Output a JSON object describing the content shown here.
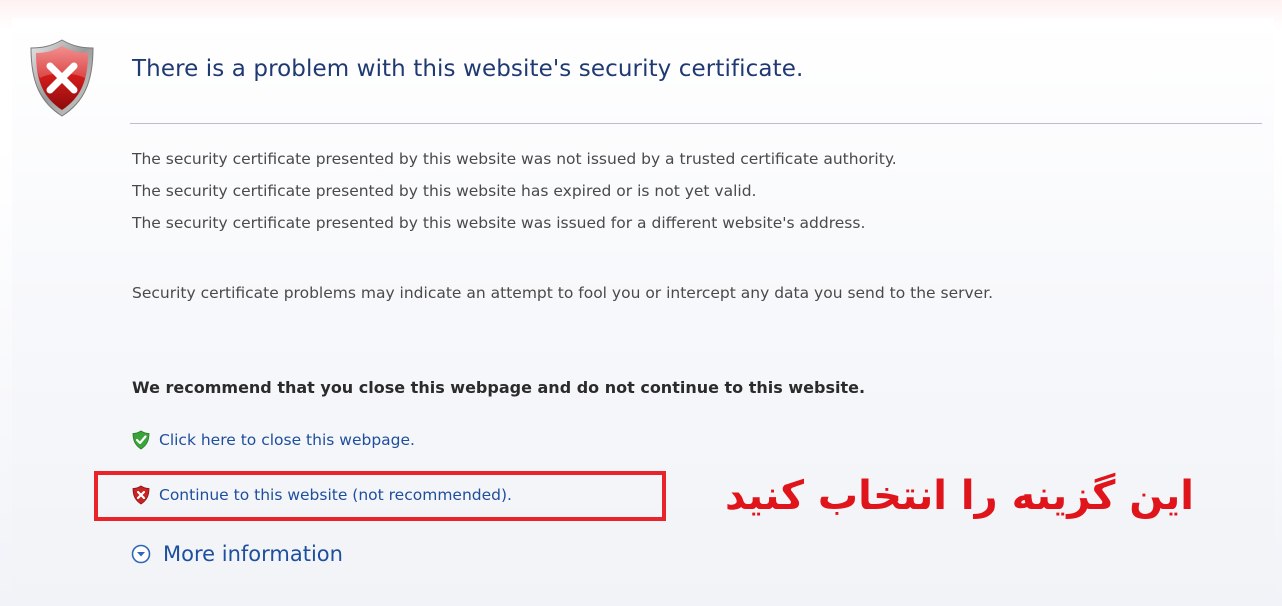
{
  "header": {
    "title": "There is a problem with this website's security certificate.",
    "icon": "error-shield-icon"
  },
  "body": {
    "reasons": [
      "The security certificate presented by this website was not issued by a trusted certificate authority.",
      "The security certificate presented by this website has expired or is not yet valid.",
      "The security certificate presented by this website was issued for a different website's address."
    ],
    "warning": "Security certificate problems may indicate an attempt to fool you or intercept any data you send to the server.",
    "recommendation": "We recommend that you close this webpage and do not continue to this website."
  },
  "actions": {
    "close_label": "Click here to close this webpage.",
    "close_icon": "green-shield-check-icon",
    "continue_label": "Continue to this website (not recommended).",
    "continue_icon": "red-shield-x-icon",
    "more_info_label": "More information",
    "more_info_icon": "chevron-down-circle-icon"
  },
  "annotation": {
    "text": "این گزینه را انتخاب کنید",
    "color": "#e0141b"
  },
  "colors": {
    "title": "#1f3a73",
    "link": "#1e4e9e",
    "highlight_box": "#e8232a"
  }
}
